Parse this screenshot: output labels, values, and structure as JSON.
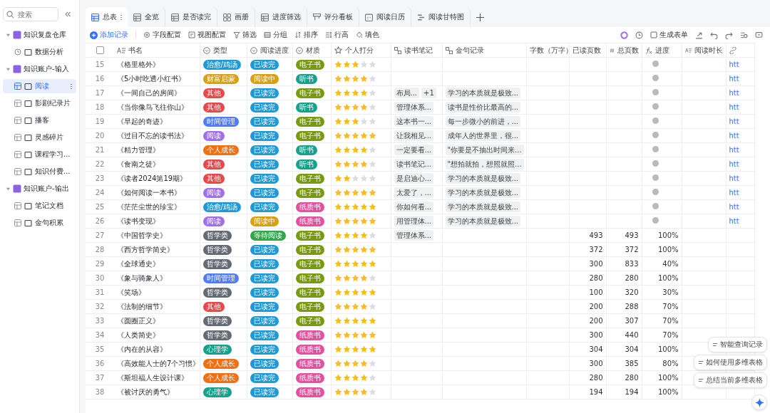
{
  "sidebar": {
    "search": {
      "placeholder": "搜索"
    },
    "tree": [
      {
        "label": "知识复盘仓库",
        "expanded": true,
        "children": [
          {
            "label": "数据分析",
            "kind": "dashboard",
            "selected": false
          }
        ]
      },
      {
        "label": "知识账户-输入",
        "expanded": true,
        "children": [
          {
            "label": "阅读",
            "kind": "table",
            "selected": true
          },
          {
            "label": "影剧纪录片",
            "kind": "table",
            "selected": false
          },
          {
            "label": "播客",
            "kind": "table",
            "selected": false
          },
          {
            "label": "灵感碎片",
            "kind": "table",
            "selected": false
          },
          {
            "label": "课程学习...",
            "kind": "table",
            "selected": false
          },
          {
            "label": "知识付费...",
            "kind": "table",
            "selected": false
          }
        ]
      },
      {
        "label": "知识账户-输出",
        "expanded": true,
        "children": [
          {
            "label": "笔记文档",
            "kind": "table",
            "selected": false
          },
          {
            "label": "金句积累",
            "kind": "table",
            "selected": false
          }
        ]
      }
    ]
  },
  "tabs": [
    {
      "label": "总表",
      "kind": "grid",
      "selected": true
    },
    {
      "label": "全览",
      "kind": "grid",
      "selected": false
    },
    {
      "label": "是否读完",
      "kind": "grid",
      "selected": false
    },
    {
      "label": "画册",
      "kind": "gallery",
      "selected": false
    },
    {
      "label": "进度筛选",
      "kind": "grid",
      "selected": false
    },
    {
      "label": "评分看板",
      "kind": "board",
      "selected": false
    },
    {
      "label": "阅读日历",
      "kind": "calendar",
      "selected": false
    },
    {
      "label": "阅读甘特图",
      "kind": "gantt",
      "selected": false
    }
  ],
  "toolbar": {
    "add": "添加记录",
    "tools": [
      "字段配置",
      "视图配置",
      "筛选",
      "分组",
      "排序",
      "行高",
      "填色"
    ],
    "form": "生成表单"
  },
  "table": {
    "select_all": {
      "checked": false
    },
    "columns": [
      {
        "label": "书名",
        "kind": "text"
      },
      {
        "label": "类型",
        "kind": "select"
      },
      {
        "label": "阅读进度",
        "kind": "select"
      },
      {
        "label": "材质",
        "kind": "select"
      },
      {
        "label": "个人打分",
        "kind": "rating"
      },
      {
        "label": "读书笔记",
        "kind": "link"
      },
      {
        "label": "金句记录",
        "kind": "link"
      },
      {
        "label": "字数（万字）",
        "kind": "plain"
      },
      {
        "label": "已读页数",
        "kind": "plain"
      },
      {
        "label": "总页数",
        "kind": "number"
      },
      {
        "label": "进度",
        "kind": "formula"
      },
      {
        "label": "阅读时长",
        "kind": "text"
      },
      {
        "kind": "url"
      }
    ],
    "rows": [
      {
        "no": "15",
        "title": "《格里格外》",
        "type": {
          "text": "治愈/鸡汤",
          "color": "#1e9bd7"
        },
        "status": {
          "text": "已读完",
          "color": "#1e9bd7"
        },
        "format": {
          "text": "电子书",
          "color": "#7a9a0e"
        },
        "stars": 3,
        "link": "htt"
      },
      {
        "no": "16",
        "title": "《5小时吃透小红书》",
        "type": {
          "text": "财富启蒙",
          "color": "#d9a012"
        },
        "status": {
          "text": "阅读中",
          "color": "#d9a012"
        },
        "format": {
          "text": "听书",
          "color": "#14a28a"
        },
        "stars": 4,
        "link": "htt"
      },
      {
        "no": "17",
        "title": "《一间自己的房间》",
        "type": {
          "text": "其他",
          "color": "#e9474a"
        },
        "status": {
          "text": "已读完",
          "color": "#1e9bd7"
        },
        "format": {
          "text": "电子书",
          "color": "#7a9a0e"
        },
        "stars": 4,
        "notes": [
          "布局...",
          "+1"
        ],
        "quote": "学习的本质就是极致...",
        "link": "htt"
      },
      {
        "no": "18",
        "title": "《当你像鸟飞往你山》",
        "type": {
          "text": "其他",
          "color": "#e9474a"
        },
        "status": {
          "text": "已读完",
          "color": "#1e9bd7"
        },
        "format": {
          "text": "听书",
          "color": "#14a28a"
        },
        "stars": 4,
        "notes": [
          "管理体系..."
        ],
        "quote": "读书是性价比最高的...",
        "link": "htt"
      },
      {
        "no": "19",
        "title": "《早起的奇迹》",
        "type": {
          "text": "时间管理",
          "color": "#4f7cf7"
        },
        "status": {
          "text": "已读完",
          "color": "#1e9bd7"
        },
        "format": {
          "text": "电子书",
          "color": "#7a9a0e"
        },
        "stars": 3,
        "notes": [
          "这本书一..."
        ],
        "quote": "每一步微小的前进，...",
        "link": "htt"
      },
      {
        "no": "20",
        "title": "《过目不忘的读书法》",
        "type": {
          "text": "阅读",
          "color": "#a070e8"
        },
        "status": {
          "text": "已读完",
          "color": "#1e9bd7"
        },
        "format": {
          "text": "电子书",
          "color": "#7a9a0e"
        },
        "stars": 5,
        "notes": [
          "让我相见..."
        ],
        "quote": "成年人的世界里，很...",
        "link": "htt"
      },
      {
        "no": "21",
        "title": "《精力管理》",
        "type": {
          "text": "个人成长",
          "color": "#f07014"
        },
        "status": {
          "text": "已读完",
          "color": "#1e9bd7"
        },
        "format": {
          "text": "听书",
          "color": "#14a28a"
        },
        "stars": 4,
        "notes": [
          "一定要看..."
        ],
        "quote": "\"你要是不抽出时间来...",
        "link": "htt"
      },
      {
        "no": "22",
        "title": "《食南之徒》",
        "type": {
          "text": "其他",
          "color": "#e9474a"
        },
        "status": {
          "text": "已读完",
          "color": "#1e9bd7"
        },
        "format": {
          "text": "听书",
          "color": "#14a28a"
        },
        "stars": 4,
        "notes": [
          "读书笔记..."
        ],
        "quote": "\"想拍就拍，想照就照...",
        "link": "htt"
      },
      {
        "no": "23",
        "title": "《读者2024第19期》",
        "type": {
          "text": "其他",
          "color": "#e9474a"
        },
        "status": {
          "text": "已读完",
          "color": "#1e9bd7"
        },
        "format": {
          "text": "电子书",
          "color": "#7a9a0e"
        },
        "stars": 2,
        "notes": [
          "是启迪心..."
        ],
        "quote": "学习的本质就是极致...",
        "link": "htt"
      },
      {
        "no": "24",
        "title": "《如何阅读一本书》",
        "type": {
          "text": "阅读",
          "color": "#a070e8"
        },
        "status": {
          "text": "已读完",
          "color": "#1e9bd7"
        },
        "format": {
          "text": "电子书",
          "color": "#7a9a0e"
        },
        "stars": 5,
        "notes": [
          "太爱了，..."
        ],
        "quote": "学习的本质就是极致...",
        "link": "htt"
      },
      {
        "no": "25",
        "title": "《茫茫尘世的珍宝》",
        "type": {
          "text": "治愈/鸡汤",
          "color": "#1e9bd7"
        },
        "status": {
          "text": "已读完",
          "color": "#1e9bd7"
        },
        "format": {
          "text": "纸质书",
          "color": "#e4509e"
        },
        "stars": 5,
        "notes": [
          "你如何看..."
        ],
        "quote": "学习的本质就是极致...",
        "link": "htt"
      },
      {
        "no": "26",
        "title": "《读书变现》",
        "type": {
          "text": "阅读",
          "color": "#a070e8"
        },
        "status": {
          "text": "阅读中",
          "color": "#d9a012"
        },
        "format": {
          "text": "纸质书",
          "color": "#e4509e"
        },
        "stars": 5,
        "notes": [
          "用管理体..."
        ],
        "quote": "学习的本质就是极致...",
        "link": "htt"
      },
      {
        "no": "27",
        "title": "《中国哲学史》",
        "type": {
          "text": "哲学类",
          "color": "#646a73"
        },
        "status": {
          "text": "等待阅读",
          "color": "#2ea84a"
        },
        "format": {
          "text": "电子书",
          "color": "#7a9a0e"
        },
        "stars": 4,
        "notes": [
          "管理体系..."
        ],
        "read": "493",
        "total": "493",
        "progress": "100%"
      },
      {
        "no": "28",
        "title": "《西方哲学简史》",
        "type": {
          "text": "哲学类",
          "color": "#646a73"
        },
        "status": {
          "text": "已读完",
          "color": "#1e9bd7"
        },
        "format": {
          "text": "电子书",
          "color": "#7a9a0e"
        },
        "stars": 5,
        "read": "372",
        "total": "372",
        "progress": "100%"
      },
      {
        "no": "29",
        "title": "《全球通史》",
        "type": {
          "text": "哲学类",
          "color": "#646a73"
        },
        "status": {
          "text": "已读完",
          "color": "#1e9bd7"
        },
        "format": {
          "text": "电子书",
          "color": "#7a9a0e"
        },
        "stars": 5,
        "read": "300",
        "total": "833",
        "progress": "40%"
      },
      {
        "no": "30",
        "title": "《象与骑象人》",
        "type": {
          "text": "时间管理",
          "color": "#4f7cf7"
        },
        "status": {
          "text": "已读完",
          "color": "#1e9bd7"
        },
        "format": {
          "text": "电子书",
          "color": "#7a9a0e"
        },
        "stars": 4,
        "read": "280",
        "total": "280",
        "progress": "100%"
      },
      {
        "no": "31",
        "title": "《笑场》",
        "type": {
          "text": "哲学类",
          "color": "#646a73"
        },
        "status": {
          "text": "已读完",
          "color": "#1e9bd7"
        },
        "format": {
          "text": "电子书",
          "color": "#7a9a0e"
        },
        "stars": 5,
        "read": "100",
        "total": "320",
        "progress": "30%"
      },
      {
        "no": "32",
        "title": "《法制的细节》",
        "type": {
          "text": "其他",
          "color": "#e9474a"
        },
        "status": {
          "text": "已读完",
          "color": "#1e9bd7"
        },
        "format": {
          "text": "电子书",
          "color": "#7a9a0e"
        },
        "stars": 4,
        "read": "200",
        "total": "288",
        "progress": "70%"
      },
      {
        "no": "33",
        "title": "《圆圈正义》",
        "type": {
          "text": "哲学类",
          "color": "#646a73"
        },
        "status": {
          "text": "已读完",
          "color": "#1e9bd7"
        },
        "format": {
          "text": "电子书",
          "color": "#7a9a0e"
        },
        "stars": 5,
        "read": "200",
        "total": "307",
        "progress": "70%"
      },
      {
        "no": "34",
        "title": "《人类简史》",
        "type": {
          "text": "哲学类",
          "color": "#646a73"
        },
        "status": {
          "text": "已读完",
          "color": "#1e9bd7"
        },
        "format": {
          "text": "纸质书",
          "color": "#e4509e"
        },
        "stars": 5,
        "read": "300",
        "total": "440",
        "progress": "70%"
      },
      {
        "no": "35",
        "title": "《内在的从容》",
        "type": {
          "text": "心理学",
          "color": "#14a28a"
        },
        "status": {
          "text": "已读完",
          "color": "#1e9bd7"
        },
        "format": {
          "text": "纸质书",
          "color": "#e4509e"
        },
        "stars": 5,
        "read": "304",
        "total": "304",
        "progress": "100%"
      },
      {
        "no": "36",
        "title": "《高效能人士的7个习惯》",
        "type": {
          "text": "个人成长",
          "color": "#f07014"
        },
        "status": {
          "text": "已读完",
          "color": "#1e9bd7"
        },
        "format": {
          "text": "纸质书",
          "color": "#e4509e"
        },
        "stars": 4,
        "read": "300",
        "total": "385",
        "progress": "80%"
      },
      {
        "no": "37",
        "title": "《斯坦福人生设计课》",
        "type": {
          "text": "个人成长",
          "color": "#f07014"
        },
        "status": {
          "text": "已读完",
          "color": "#1e9bd7"
        },
        "format": {
          "text": "纸质书",
          "color": "#e4509e"
        },
        "stars": 4,
        "read": "280",
        "total": "280",
        "progress": "100%"
      },
      {
        "no": "38",
        "title": "《被讨厌的勇气》",
        "type": {
          "text": "心理学",
          "color": "#14a28a"
        },
        "status": {
          "text": "已读完",
          "color": "#1e9bd7"
        },
        "format": {
          "text": "纸质书",
          "color": "#e4509e"
        },
        "stars": 4,
        "read": "194",
        "total": "194",
        "progress": "100%"
      }
    ]
  },
  "assistant": {
    "actions": [
      "智能查询记录",
      "如何使用多维表格",
      "总结当前多维表格"
    ]
  }
}
